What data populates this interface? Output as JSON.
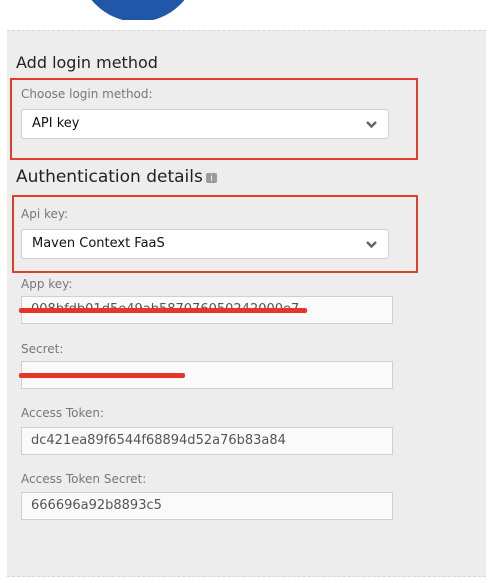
{
  "header": {
    "add_login_method": "Add login method",
    "auth_details": "Authentication details"
  },
  "login_method": {
    "label": "Choose login method:",
    "value": "API key"
  },
  "api_key": {
    "label": "Api key:",
    "value": "Maven Context FaaS"
  },
  "app_key": {
    "label": "App key:",
    "value": "008bfdb01d5e49ab587076050242000e7"
  },
  "secret": {
    "label": "Secret:",
    "value": ""
  },
  "access_token": {
    "label": "Access Token:",
    "value": "dc421ea89f6544f68894d52a76b83a84"
  },
  "access_token_secret": {
    "label": "Access Token Secret:",
    "value": "666696a92b8893c5"
  },
  "colors": {
    "highlight": "#e0402a",
    "redaction": "#e8352a",
    "accent_circle": "#2157a8"
  },
  "icons": [
    "chevron-down-icon",
    "info-icon"
  ]
}
